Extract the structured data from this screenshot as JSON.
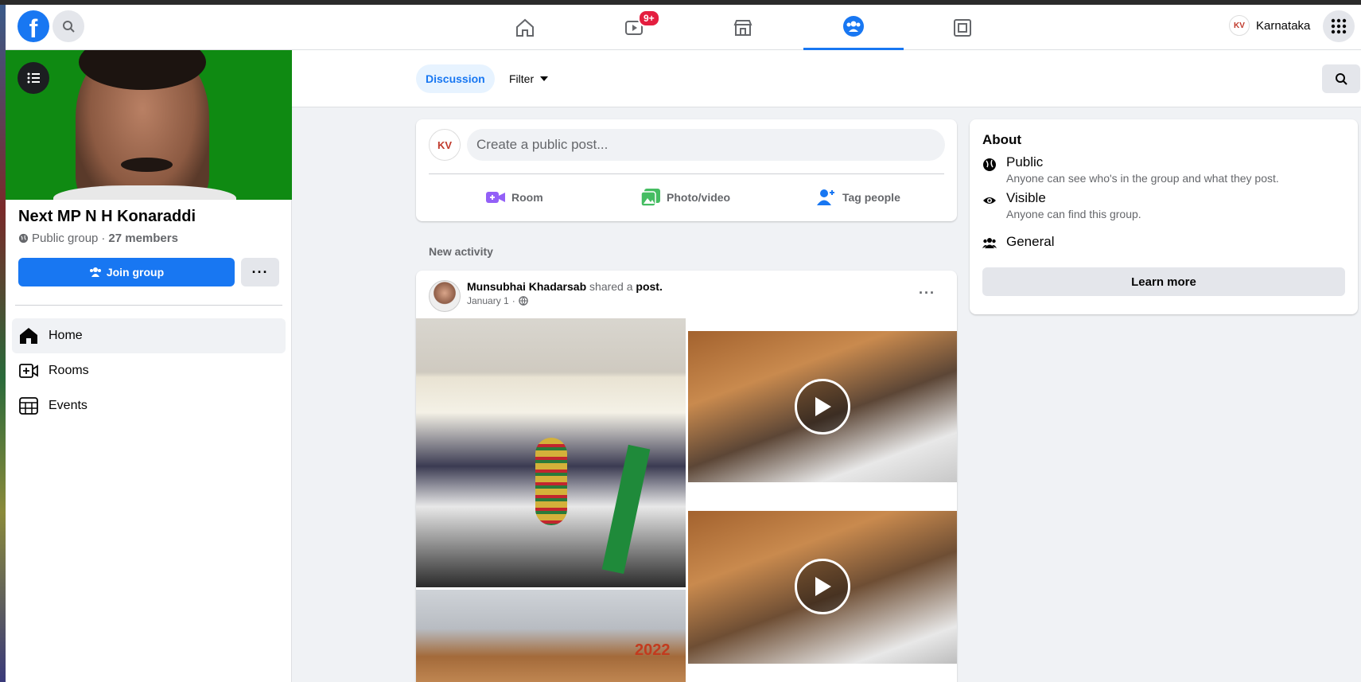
{
  "topbar": {
    "logo_letter": "f",
    "notification_badge": "9+",
    "user_name": "Karnataka",
    "user_logo_text": "KV"
  },
  "group": {
    "name": "Next MP N H Konaraddi",
    "privacy": "Public group",
    "separator": " · ",
    "members": "27 members",
    "join_label": "Join group",
    "more_label": "···"
  },
  "sidebar": {
    "items": [
      {
        "label": "Home",
        "icon": "home-icon",
        "active": true
      },
      {
        "label": "Rooms",
        "icon": "rooms-icon",
        "active": false
      },
      {
        "label": "Events",
        "icon": "events-icon",
        "active": false
      }
    ]
  },
  "subheader": {
    "discussion_label": "Discussion",
    "filter_label": "Filter"
  },
  "composer": {
    "avatar_text": "KV",
    "placeholder": "Create a public post...",
    "actions": [
      {
        "label": "Room",
        "icon": "video-room-icon",
        "color": "#9360f7"
      },
      {
        "label": "Photo/video",
        "icon": "photo-icon",
        "color": "#45bd62"
      },
      {
        "label": "Tag people",
        "icon": "tag-people-icon",
        "color": "#1877f2"
      }
    ]
  },
  "feed": {
    "section_label": "New activity",
    "post": {
      "author": "Munsubhai Khadarsab",
      "action_text": "shared a",
      "object_text": "post.",
      "date": "January 1",
      "date_separator": " · ",
      "more_label": "···",
      "banner_year": "2022"
    }
  },
  "about": {
    "title": "About",
    "rows": [
      {
        "title": "Public",
        "subtitle": "Anyone can see who's in the group and what they post.",
        "icon": "globe-icon"
      },
      {
        "title": "Visible",
        "subtitle": "Anyone can find this group.",
        "icon": "eye-icon"
      },
      {
        "title": "General",
        "subtitle": "",
        "icon": "people-icon"
      }
    ],
    "learn_more_label": "Learn more"
  },
  "colors": {
    "accent": "#1877f2",
    "cover_green": "#0f8a12",
    "badge_red": "#e41e3f"
  }
}
